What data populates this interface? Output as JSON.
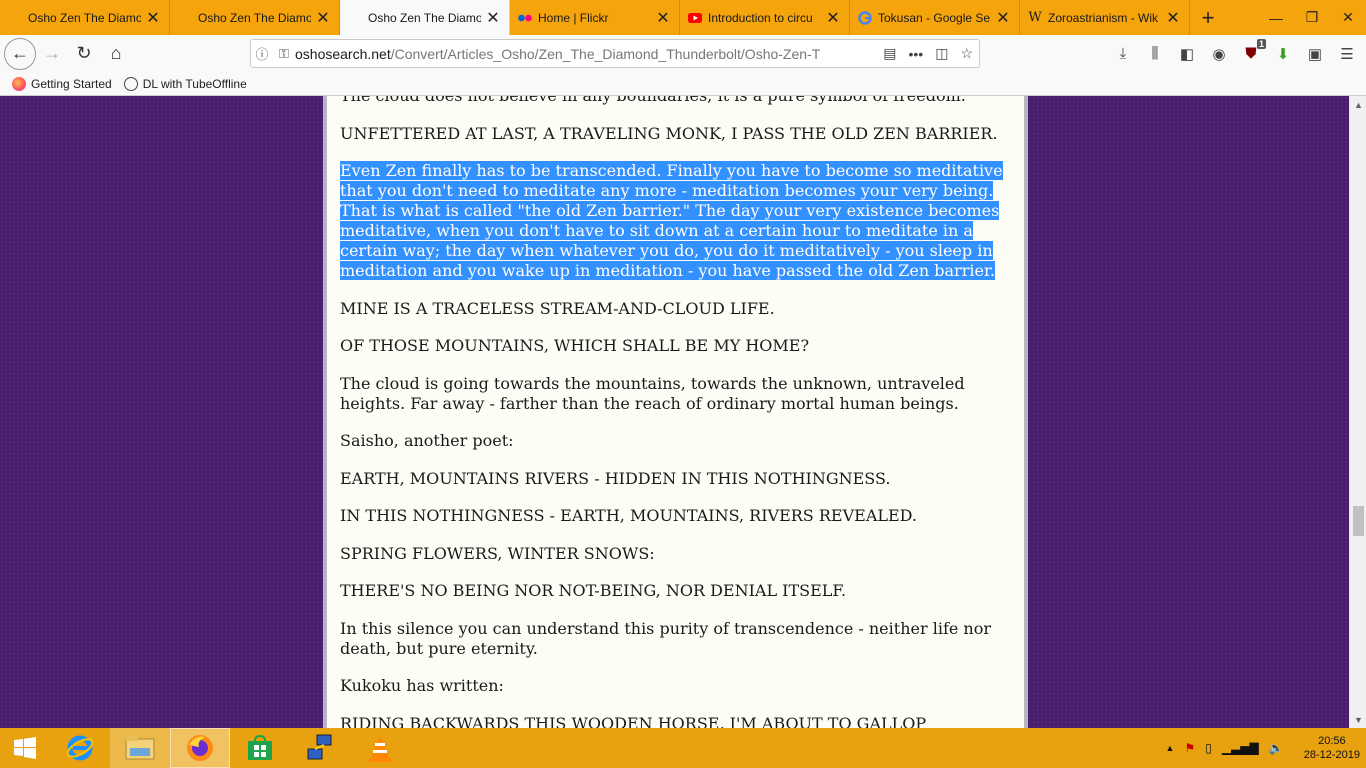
{
  "tabs": [
    {
      "title": "Osho Zen The Diamond",
      "icon": "osho-favicon",
      "active": false
    },
    {
      "title": "Osho Zen The Diamond",
      "icon": "osho-favicon",
      "active": false
    },
    {
      "title": "Osho Zen The Diamond",
      "icon": "osho-favicon",
      "active": true
    },
    {
      "title": "Home | Flickr",
      "icon": "flickr-icon",
      "active": false
    },
    {
      "title": "Introduction to circu",
      "icon": "youtube-icon",
      "active": false
    },
    {
      "title": "Tokusan - Google Se",
      "icon": "google-icon",
      "active": false
    },
    {
      "title": "Zoroastrianism - Wik",
      "icon": "wikipedia-icon",
      "active": false
    }
  ],
  "urlbar": {
    "host": "oshosearch.net",
    "path": "/Convert/Articles_Osho/Zen_The_Diamond_Thunderbolt/Osho-Zen-T"
  },
  "bookmarks": [
    {
      "label": "Getting Started",
      "icon": "firefox-icon"
    },
    {
      "label": "DL with TubeOffline",
      "icon": "globe-icon"
    }
  ],
  "toolbar": {
    "ublock_badge": "1"
  },
  "article": {
    "paragraphs": [
      {
        "text": "The cloud does not believe in any boundaries; it is a pure symbol of freedom.",
        "selected": false
      },
      {
        "text": "UNFETTERED AT LAST, A TRAVELING MONK, I PASS THE OLD ZEN BARRIER.",
        "selected": false
      },
      {
        "text": "Even Zen finally has to be transcended. Finally you have to become so meditative that you don't need to meditate any more - meditation becomes your very being. That is what is called \"the old Zen barrier.\" The day your very existence becomes meditative, when you don't have to sit down at a certain hour to meditate in a certain way; the day when whatever you do, you do it meditatively - you sleep in meditation and you wake up in meditation - you have passed the old Zen barrier.",
        "selected": true
      },
      {
        "text": "MINE IS A TRACELESS STREAM-AND-CLOUD LIFE.",
        "selected": false
      },
      {
        "text": "OF THOSE MOUNTAINS, WHICH SHALL BE MY HOME?",
        "selected": false
      },
      {
        "text": "The cloud is going towards the mountains, towards the unknown, untraveled heights. Far away - farther than the reach of ordinary mortal human beings.",
        "selected": false
      },
      {
        "text": "Saisho, another poet:",
        "selected": false
      },
      {
        "text": "EARTH, MOUNTAINS RIVERS - HIDDEN IN THIS NOTHINGNESS.",
        "selected": false
      },
      {
        "text": "IN THIS NOTHINGNESS - EARTH, MOUNTAINS, RIVERS REVEALED.",
        "selected": false
      },
      {
        "text": "SPRING FLOWERS, WINTER SNOWS:",
        "selected": false
      },
      {
        "text": "THERE'S NO BEING NOR NOT-BEING, NOR DENIAL ITSELF.",
        "selected": false
      },
      {
        "text": "In this silence you can understand this purity of transcendence - neither life nor death, but pure eternity.",
        "selected": false
      },
      {
        "text": "Kukoku has written:",
        "selected": false
      },
      {
        "text": "RIDING BACKWARDS THIS WOODEN HORSE, I'M ABOUT TO GALLOP",
        "selected": false
      }
    ]
  },
  "taskbar": {
    "apps": [
      "start-icon",
      "internet-explorer-icon",
      "file-explorer-icon",
      "firefox-icon",
      "store-icon",
      "network-tool-icon",
      "vlc-icon"
    ],
    "clock_time": "20:56",
    "clock_date": "28-12-2019"
  },
  "colors": {
    "selection": "#3390ff",
    "tabstrip": "#f5a40c",
    "page_background": "#4b1d6e"
  }
}
